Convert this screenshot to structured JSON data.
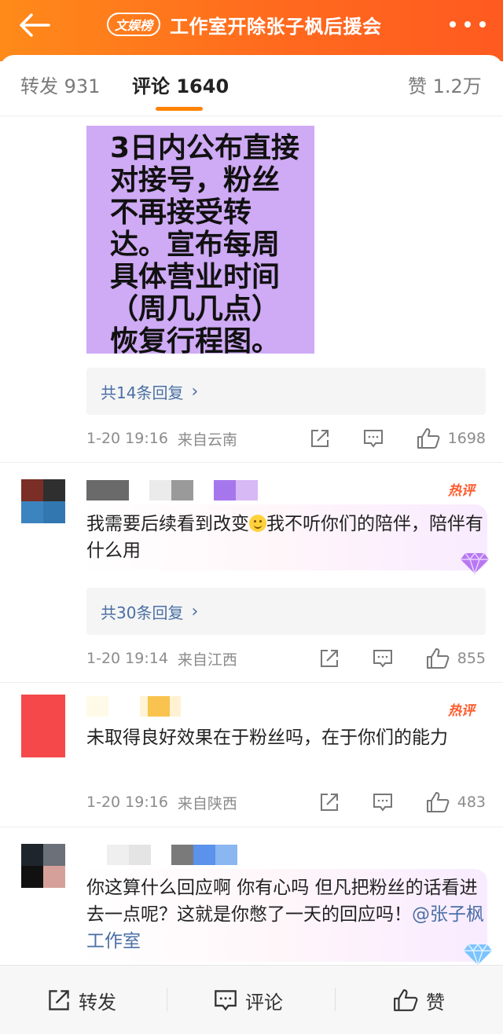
{
  "header": {
    "brand": "文娱榜",
    "title": "工作室开除张子枫后援会"
  },
  "tabs": {
    "repost": "转发 931",
    "comments": "评论 1640",
    "likes": "赞 1.2万"
  },
  "post": {
    "image_text": "3日内公布直接对接号，粉丝不再接受转达。宣布每周具体营业时间（周几几点）恢复行程图。",
    "replies": "共14条回复",
    "time": "1-20 19:16",
    "location": "来自云南",
    "like_count": "1698"
  },
  "comments": [
    {
      "hot": "热评",
      "text_a": "我需要后续看到改变",
      "text_b": "我不听你们的陪伴，陪伴有什么用",
      "replies": "共30条回复",
      "time": "1-20 19:14",
      "location": "来自江西",
      "like_count": "855"
    },
    {
      "hot": "热评",
      "text": "未取得良好效果在于粉丝吗，在于你们的能力",
      "time": "1-20 19:16",
      "location": "来自陕西",
      "like_count": "483"
    },
    {
      "text": "你这算什么回应啊 你有心吗 但凡把粉丝的话看进去一点呢？这就是你憋了一天的回应吗！",
      "mention": "@张子枫工作室"
    }
  ],
  "bottom_bar": {
    "repost": "转发",
    "comment": "评论",
    "like": "赞"
  },
  "colors": {
    "header_start": "#ff8a1a",
    "header_end": "#ff5a20",
    "accent": "#ff8200",
    "link": "#4a6fa5",
    "image_bg": "#cfaaf5",
    "hot": "#ff5a2c"
  }
}
